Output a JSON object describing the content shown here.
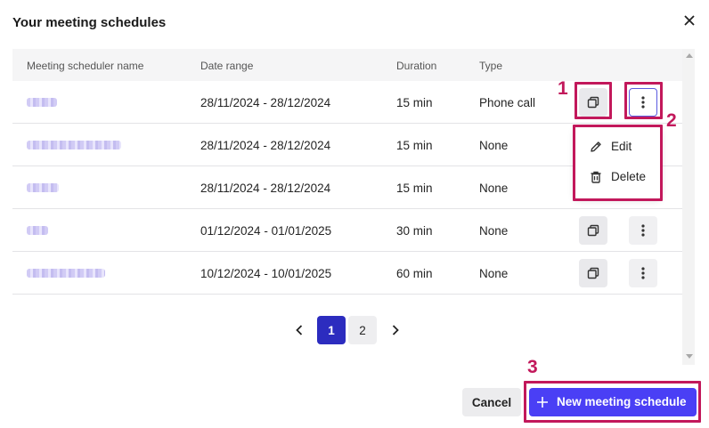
{
  "dialog": {
    "title": "Your meeting schedules"
  },
  "table": {
    "headers": [
      "Meeting scheduler name",
      "Date range",
      "Duration",
      "Type"
    ],
    "rows": [
      {
        "date_range": "28/11/2024 - 28/12/2024",
        "duration": "15 min",
        "type": "Phone call"
      },
      {
        "date_range": "28/11/2024 - 28/12/2024",
        "duration": "15 min",
        "type": "None"
      },
      {
        "date_range": "28/11/2024 - 28/12/2024",
        "duration": "15 min",
        "type": "None"
      },
      {
        "date_range": "01/12/2024 - 01/01/2025",
        "duration": "30 min",
        "type": "None"
      },
      {
        "date_range": "10/12/2024 - 10/01/2025",
        "duration": "60 min",
        "type": "None"
      }
    ]
  },
  "menu": {
    "edit": "Edit",
    "delete": "Delete"
  },
  "pagination": {
    "pages": [
      "1",
      "2"
    ],
    "current": "1"
  },
  "actions": {
    "cancel": "Cancel",
    "new_schedule": "New meeting schedule"
  },
  "annotations": [
    "1",
    "2",
    "3"
  ],
  "colors": {
    "accent": "#4a3ff5",
    "current_page": "#2c2cbf",
    "annotation": "#c2185b"
  }
}
